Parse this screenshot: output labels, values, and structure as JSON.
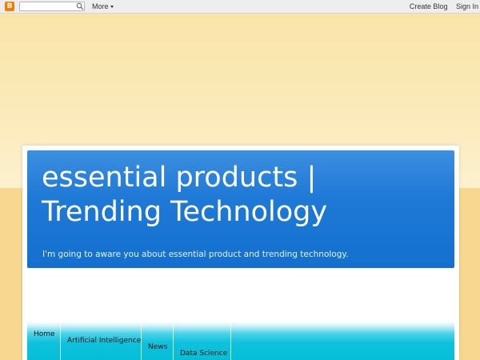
{
  "navbar": {
    "logo_letter": "B",
    "search_placeholder": "",
    "more_label": "More",
    "create_blog_label": "Create Blog",
    "sign_in_label": "Sign In"
  },
  "header": {
    "title": "essential products | Trending Technology",
    "description": "I'm going to aware you about essential product and trending technology."
  },
  "tabs": [
    {
      "label": "Home"
    },
    {
      "label": "Artificial Intelligence"
    },
    {
      "label": "News"
    },
    {
      "label": "Data Science"
    }
  ],
  "colors": {
    "header_blue": "#1f79d6",
    "tabs_cyan": "#0fc1dc",
    "background": "#f8d891",
    "blogger_orange": "#f57d00"
  }
}
